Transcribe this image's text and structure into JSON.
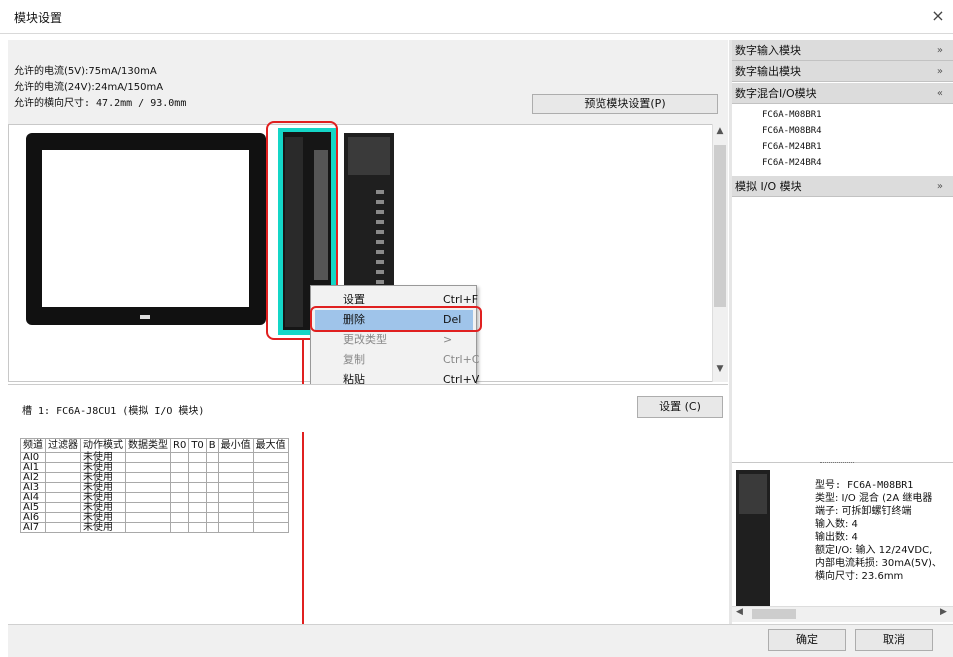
{
  "window": {
    "title": "模块设置",
    "close_glyph": "×"
  },
  "info": {
    "current_5v": "允许的电流(5V):75mA/130mA",
    "current_24v": "允许的电流(24V):24mA/150mA",
    "width": "允许的横向尺寸: 47.2mm / 93.0mm",
    "preview_button": "预览模块设置(P)"
  },
  "context_menu": {
    "items": [
      {
        "label": "设置",
        "shortcut": "Ctrl+F"
      },
      {
        "label": "删除",
        "shortcut": "Del"
      },
      {
        "label": "更改类型",
        "shortcut": ">"
      },
      {
        "label": "复制",
        "shortcut": "Ctrl+C"
      },
      {
        "label": "粘贴",
        "shortcut": "Ctrl+V"
      }
    ],
    "highlighted": "删除"
  },
  "slot": {
    "label": "槽 1: FC6A-J8CU1 (模拟 I/O 模块)",
    "settings_button": "设置 (C)"
  },
  "table": {
    "headers": [
      "频道",
      "过滤器",
      "动作模式",
      "数据类型",
      "R0",
      "T0",
      "B",
      "最小值",
      "最大值"
    ],
    "rows": [
      [
        "AI0",
        "",
        "未使用"
      ],
      [
        "AI1",
        "",
        "未使用"
      ],
      [
        "AI2",
        "",
        "未使用"
      ],
      [
        "AI3",
        "",
        "未使用"
      ],
      [
        "AI4",
        "",
        "未使用"
      ],
      [
        "AI5",
        "",
        "未使用"
      ],
      [
        "AI6",
        "",
        "未使用"
      ],
      [
        "AI7",
        "",
        "未使用"
      ]
    ]
  },
  "right_panel": {
    "categories": [
      {
        "label": "数字输入模块",
        "chevron": "»"
      },
      {
        "label": "数字输出模块",
        "chevron": "»"
      },
      {
        "label": "数字混合I/O模块",
        "chevron": "«"
      },
      {
        "label": "模拟 I/O 模块",
        "chevron": "»"
      }
    ],
    "mixed_items": [
      "FC6A-M08BR1",
      "FC6A-M08BR4",
      "FC6A-M24BR1",
      "FC6A-M24BR4"
    ],
    "details": [
      "型号: FC6A-M08BR1",
      "类型: I/O 混合 (2A 继电器",
      "端子: 可拆卸螺钉终端",
      "输入数: 4",
      "输出数: 4",
      "额定I/O: 输入 12/24VDC,",
      "内部电流耗损: 30mA(5V)、",
      "横向尺寸: 23.6mm"
    ]
  },
  "footer": {
    "ok": "确定",
    "cancel": "取消"
  },
  "colors": {
    "selection_cyan": "#14d6c7",
    "annotation_red": "#e02020",
    "menu_highlight": "#9fc4ea"
  }
}
